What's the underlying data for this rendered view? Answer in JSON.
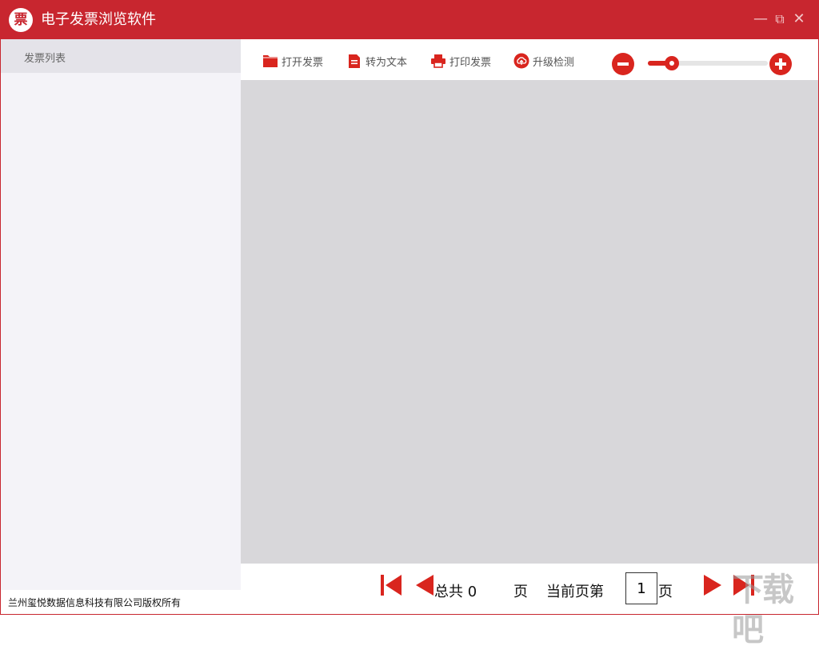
{
  "window": {
    "title": "电子发票浏览软件",
    "logo_char": "票",
    "minimize": "—",
    "maximize": "⧉",
    "close": "✕"
  },
  "sidebar": {
    "header": "发票列表"
  },
  "toolbar": {
    "open": {
      "label": "打开发票",
      "icon": "folder-icon"
    },
    "to_text": {
      "label": "转为文本",
      "icon": "document-icon"
    },
    "print": {
      "label": "打印发票",
      "icon": "printer-icon"
    },
    "update": {
      "label": "升级检测",
      "icon": "cloud-upload-icon"
    }
  },
  "zoom": {
    "level": 0.2
  },
  "pager": {
    "total_prefix": "总共",
    "total_pages": "0",
    "page_unit": "页",
    "current_prefix": "当前页第",
    "current_page": "1",
    "current_suffix": "页"
  },
  "footer": {
    "copyright": "兰州玺悦数据信息科技有限公司版权所有"
  },
  "watermark": "下载吧",
  "colors": {
    "accent": "#c8262f",
    "icon_red": "#d9251e",
    "viewer_bg": "#d8d7da",
    "sidebar_bg": "#f4f3f8"
  }
}
